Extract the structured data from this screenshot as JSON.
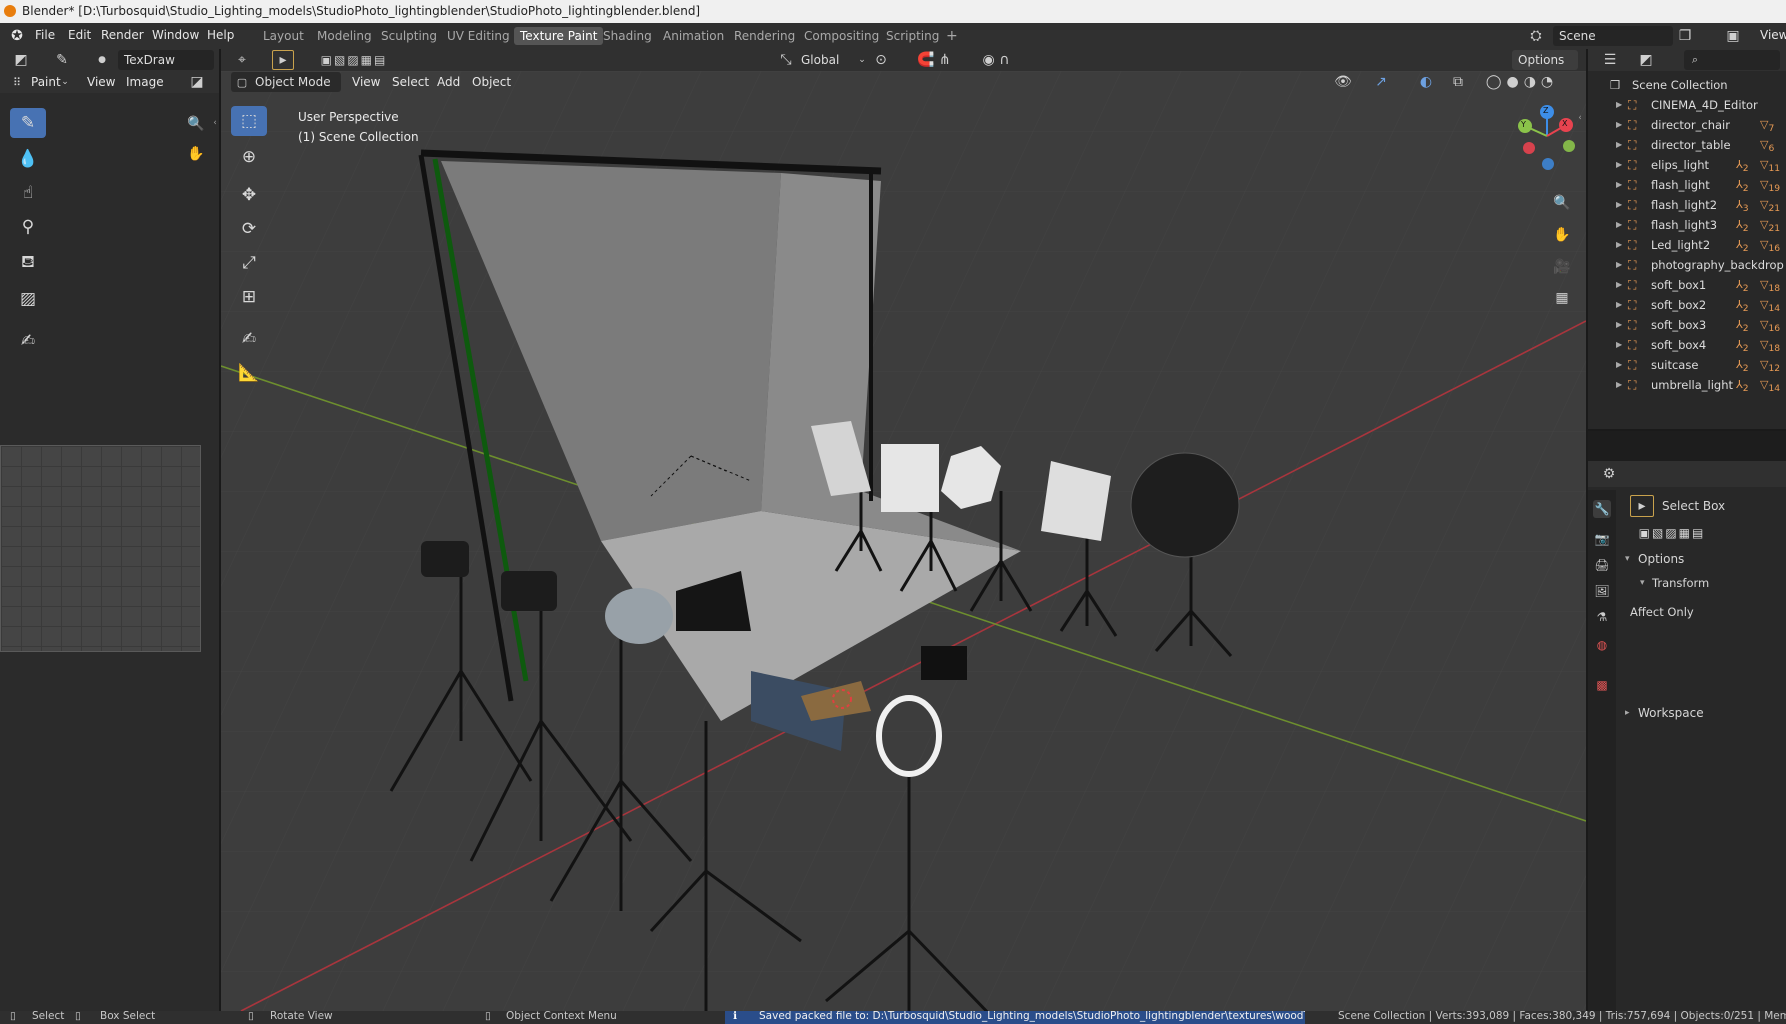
{
  "window": {
    "title": "Blender* [D:\\Turbosquid\\Studio_Lighting_models\\StudioPhoto_lightingblender\\StudioPhoto_lightingblender.blend]"
  },
  "menu": {
    "items": [
      "File",
      "Edit",
      "Render",
      "Window",
      "Help"
    ]
  },
  "workspaces": {
    "tabs": [
      "Layout",
      "Modeling",
      "Sculpting",
      "UV Editing",
      "Texture Paint",
      "Shading",
      "Animation",
      "Rendering",
      "Compositing",
      "Scripting"
    ],
    "active": "Texture Paint",
    "add": "+"
  },
  "scene": {
    "label": "Scene",
    "view_label": "View"
  },
  "image_editor": {
    "brush_name": "TexDraw",
    "mode": "Paint",
    "menu_view": "View",
    "menu_image": "Image"
  },
  "viewport": {
    "mode": "Object Mode",
    "menus": [
      "View",
      "Select",
      "Add",
      "Object"
    ],
    "transform_orientation": "Global",
    "options_label": "Options",
    "overlay_title": "User Perspective",
    "overlay_collection": "(1) Scene Collection",
    "gizmo": {
      "z": "Z",
      "y": "Y",
      "x": "X"
    }
  },
  "outliner": {
    "root": "Scene Collection",
    "items": [
      {
        "name": "CINEMA_4D_Editor",
        "mod": "",
        "mesh": ""
      },
      {
        "name": "director_chair",
        "mod": "",
        "mesh": "7"
      },
      {
        "name": "director_table",
        "mod": "",
        "mesh": "6"
      },
      {
        "name": "elips_light",
        "mod": "2",
        "mesh": "11"
      },
      {
        "name": "flash_light",
        "mod": "2",
        "mesh": "19"
      },
      {
        "name": "flash_light2",
        "mod": "3",
        "mesh": "21"
      },
      {
        "name": "flash_light3",
        "mod": "2",
        "mesh": "21"
      },
      {
        "name": "Led_light2",
        "mod": "2",
        "mesh": "16"
      },
      {
        "name": "photography_backdrop",
        "mod": "",
        "mesh": ""
      },
      {
        "name": "soft_box1",
        "mod": "2",
        "mesh": "18"
      },
      {
        "name": "soft_box2",
        "mod": "2",
        "mesh": "14"
      },
      {
        "name": "soft_box3",
        "mod": "2",
        "mesh": "16"
      },
      {
        "name": "soft_box4",
        "mod": "2",
        "mesh": "18"
      },
      {
        "name": "suitcase",
        "mod": "2",
        "mesh": "12"
      },
      {
        "name": "umbrella_light",
        "mod": "2",
        "mesh": "14"
      }
    ]
  },
  "properties": {
    "tool_name": "Select Box",
    "options": "Options",
    "transform": "Transform",
    "affect_only": "Affect Only",
    "workspace": "Workspace"
  },
  "statusbar": {
    "select": "Select",
    "box_select": "Box Select",
    "rotate_view": "Rotate View",
    "context_menu": "Object Context Menu",
    "message": "Saved packed file to: D:\\Turbosquid\\Studio_Lighting_models\\StudioPhoto_lightingblender\\textures\\woodTF.jpg",
    "stats": "Scene Collection | Verts:393,089 | Faces:380,349 | Tris:757,694 | Objects:0/251 | Mem"
  },
  "colors": {
    "accent": "#4772b3",
    "object_orange": "#e69a55",
    "axis_x": "#e8434f",
    "axis_y": "#8bc34a",
    "axis_z": "#3d8ee8"
  }
}
